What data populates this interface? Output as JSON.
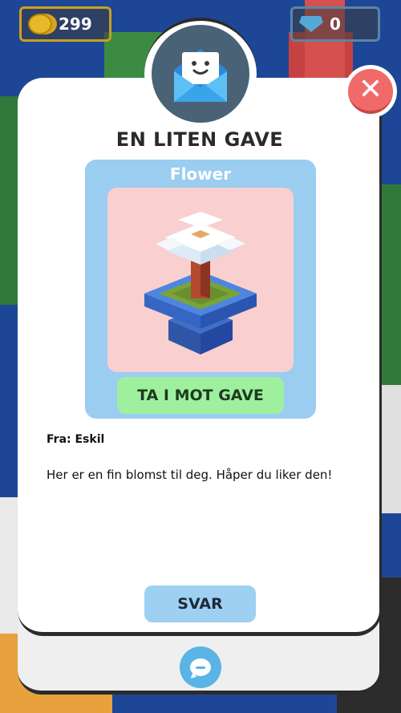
{
  "hud": {
    "coins": "299",
    "gems": "0",
    "coin_icon": "coin-stack-icon",
    "gem_icon": "gem-icon"
  },
  "dialog": {
    "title": "EN LITEN GAVE",
    "header_icon": "envelope-smile-icon",
    "close_icon": "close-icon",
    "gift": {
      "name": "Flower",
      "image": "voxel-flower-pot",
      "accept_label": "TA I MOT GAVE"
    },
    "from": "Fra: Eskil",
    "message": "Her er en fin blomst til deg. Håper du liker den!",
    "reply_label": "SVAR"
  },
  "bottom": {
    "chat_icon": "chat-bubble-icon"
  },
  "colors": {
    "accept_button": "#9ef09f",
    "reply_button": "#9ed0f2",
    "gift_card": "#9acdf0",
    "gift_image_bg": "#f9cfcf",
    "close_button": "#f06a6a"
  }
}
